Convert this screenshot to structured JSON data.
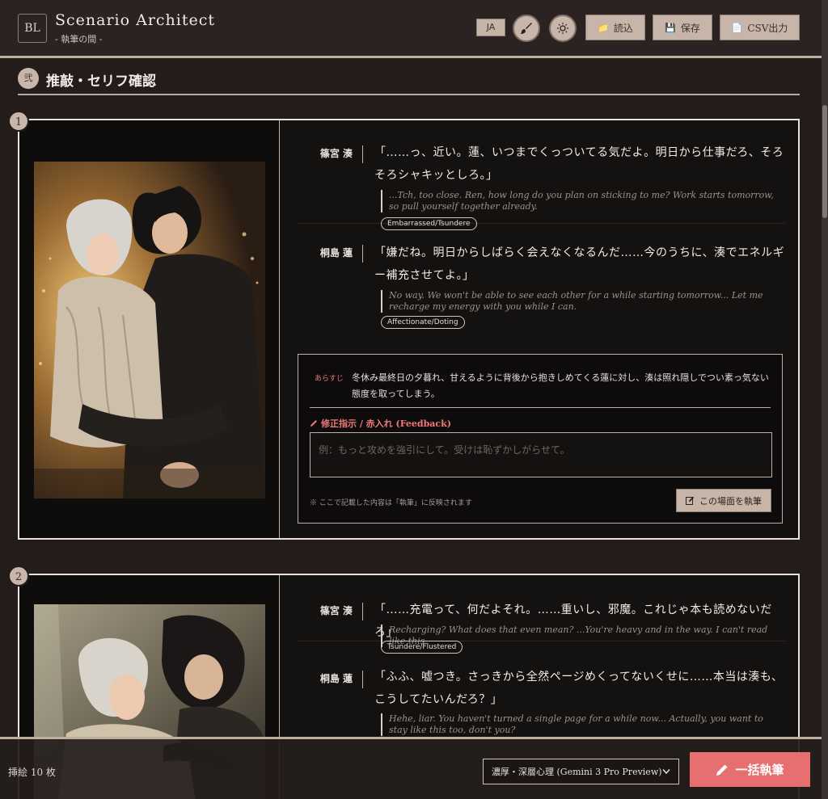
{
  "header": {
    "logo": "BL",
    "title": "Scenario Architect",
    "subtitle": "- 執筆の間 -",
    "lang_button": "JA",
    "load_label": "読込",
    "save_label": "保存",
    "csv_label": "CSV出力"
  },
  "section": {
    "badge": "弐",
    "title": "推敲・セリフ確認"
  },
  "scenes": [
    {
      "number": "1",
      "lines": [
        {
          "speaker": "篠宮 湊",
          "text": "「……っ、近い。蓮、いつまでくっついてる気だよ。明日から仕事だろ、そろそろシャキッとしろ。」",
          "translation": "...Tch, too close. Ren, how long do you plan on sticking to me? Work starts tomorrow, so pull yourself together already.",
          "emotion": "Embarrassed/Tsundere"
        },
        {
          "speaker": "桐島 蓮",
          "text": "「嫌だね。明日からしばらく会えなくなるんだ……今のうちに、湊でエネルギー補充させてよ。」",
          "translation": "No way. We won't be able to see each other for a while starting tomorrow... Let me recharge my energy with you while I can.",
          "emotion": "Affectionate/Doting"
        }
      ],
      "synopsis_label": "あらすじ",
      "synopsis": "冬休み最終日の夕暮れ、甘えるように背後から抱きしめてくる蓮に対し、湊は照れ隠しでつい素っ気ない態度を取ってしまう。",
      "feedback_label": "修正指示 / 赤入れ (Feedback)",
      "feedback_placeholder": "例：もっと攻めを強引にして。受けは恥ずかしがらせて。",
      "note": "※ ここで記載した内容は「執筆」に反映されます",
      "write_button": "この場面を執筆"
    },
    {
      "number": "2",
      "lines": [
        {
          "speaker": "篠宮 湊",
          "text": "「……充電って、何だよそれ。……重いし、邪魔。これじゃ本も読めないだろ」",
          "translation": "Recharging? What does that even mean? ...You're heavy and in the way. I can't read like this.",
          "emotion": "Tsundere/Flustered"
        },
        {
          "speaker": "桐島 蓮",
          "text": "「ふふ、嘘つき。さっきから全然ページめくってないくせに……本当は湊も、こうしてたいんだろ？」",
          "translation": "Hehe, liar. You haven't turned a single page for a while now... Actually, you want to stay like this too, don't you?",
          "emotion": ""
        }
      ]
    }
  ],
  "footer": {
    "count_label": "挿絵 10 枚",
    "model_selected": "濃厚・深層心理 (Gemini 3 Pro Preview)",
    "batch_button": "一括執筆"
  },
  "colors": {
    "background": "#231c1b",
    "accent_beige": "#c6b5a8",
    "accent_red": "#e86f6f"
  }
}
